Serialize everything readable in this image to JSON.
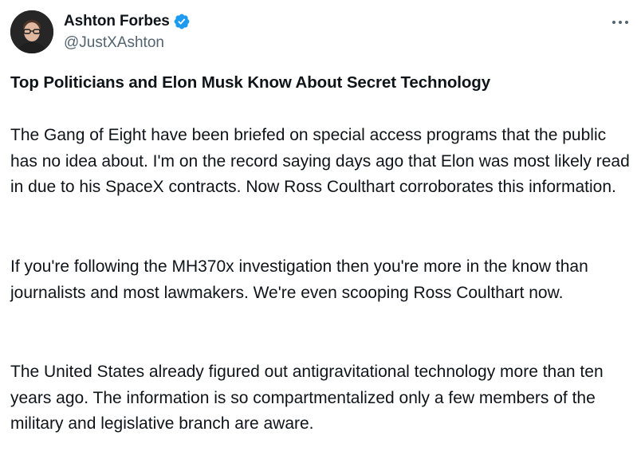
{
  "author": {
    "display_name": "Ashton Forbes",
    "handle": "@JustXAshton",
    "avatar_icon": "person-avatar",
    "verified_icon": "verified-badge-icon",
    "verified_color": "#1d9bf0"
  },
  "menu": {
    "icon": "more-options-icon"
  },
  "post": {
    "headline": "Top Politicians and Elon Musk Know About Secret Technology",
    "paragraphs": [
      "The Gang of Eight have been briefed on special access programs that the public has no idea about. I'm on the record saying days ago that Elon was most likely read in due to his SpaceX contracts. Now Ross Coulthart corroborates this information.",
      "If you're following the MH370x investigation then you're more in the know than journalists and most lawmakers. We're even scooping Ross Coulthart now.",
      "The United States already figured out antigravitational technology more than ten years ago. The information is so compartmentalized only a few members of the military and legislative branch are aware."
    ]
  },
  "colors": {
    "text_primary": "#0f1419",
    "text_secondary": "#536471",
    "accent": "#1d9bf0"
  }
}
